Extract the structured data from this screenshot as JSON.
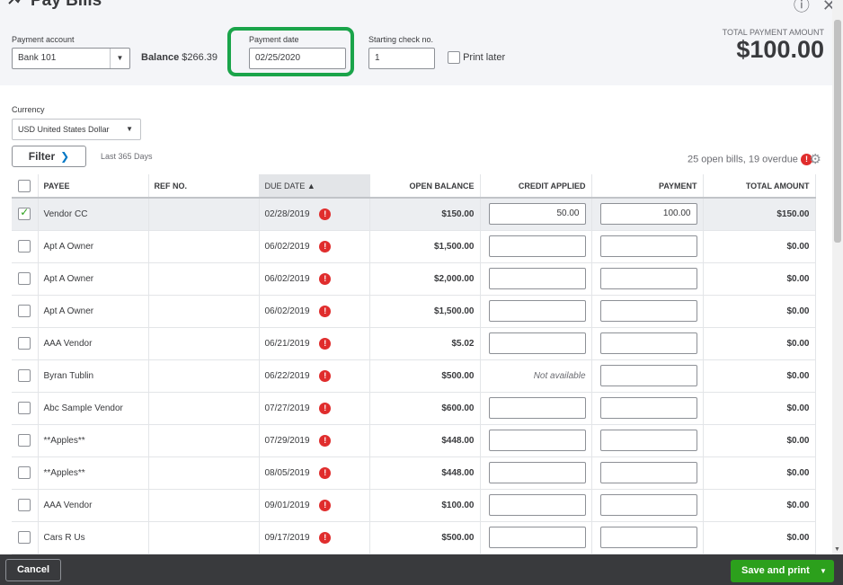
{
  "header": {
    "title": "Pay Bills",
    "help_icon": "question-circle-icon",
    "close_icon": "close-icon"
  },
  "payment": {
    "account_label": "Payment account",
    "account_value": "Bank 101",
    "balance_label": "Balance",
    "balance_value": "$266.39",
    "date_label": "Payment date",
    "date_value": "02/25/2020",
    "check_label": "Starting check no.",
    "check_value": "1",
    "print_later_label": "Print later",
    "total_label": "TOTAL PAYMENT AMOUNT",
    "total_value": "$100.00"
  },
  "currency": {
    "label": "Currency",
    "value": "USD United States Dollar"
  },
  "filter": {
    "button_label": "Filter",
    "range": "Last 365 Days",
    "summary": "25 open bills, 19 overdue"
  },
  "table": {
    "headers": {
      "payee": "PAYEE",
      "ref": "REF NO.",
      "due": "DUE DATE",
      "open": "OPEN BALANCE",
      "credit": "CREDIT APPLIED",
      "payment": "PAYMENT",
      "total": "TOTAL AMOUNT"
    },
    "rows": [
      {
        "checked": true,
        "payee": "Vendor CC",
        "ref": "",
        "due": "02/28/2019",
        "open": "$150.00",
        "credit": "50.00",
        "payment": "100.00",
        "total": "$150.00"
      },
      {
        "checked": false,
        "payee": "Apt A Owner",
        "ref": "",
        "due": "06/02/2019",
        "open": "$1,500.00",
        "credit": "",
        "payment": "",
        "total": "$0.00"
      },
      {
        "checked": false,
        "payee": "Apt A Owner",
        "ref": "",
        "due": "06/02/2019",
        "open": "$2,000.00",
        "credit": "",
        "payment": "",
        "total": "$0.00"
      },
      {
        "checked": false,
        "payee": "Apt A Owner",
        "ref": "",
        "due": "06/02/2019",
        "open": "$1,500.00",
        "credit": "",
        "payment": "",
        "total": "$0.00"
      },
      {
        "checked": false,
        "payee": "AAA Vendor",
        "ref": "",
        "due": "06/21/2019",
        "open": "$5.02",
        "credit": "",
        "payment": "",
        "total": "$0.00"
      },
      {
        "checked": false,
        "payee": "Byran Tublin",
        "ref": "",
        "due": "06/22/2019",
        "open": "$500.00",
        "credit": "Not available",
        "payment": "",
        "total": "$0.00"
      },
      {
        "checked": false,
        "payee": "Abc Sample Vendor",
        "ref": "",
        "due": "07/27/2019",
        "open": "$600.00",
        "credit": "",
        "payment": "",
        "total": "$0.00"
      },
      {
        "checked": false,
        "payee": "**Apples**",
        "ref": "",
        "due": "07/29/2019",
        "open": "$448.00",
        "credit": "",
        "payment": "",
        "total": "$0.00"
      },
      {
        "checked": false,
        "payee": "**Apples**",
        "ref": "",
        "due": "08/05/2019",
        "open": "$448.00",
        "credit": "",
        "payment": "",
        "total": "$0.00"
      },
      {
        "checked": false,
        "payee": "AAA Vendor",
        "ref": "",
        "due": "09/01/2019",
        "open": "$100.00",
        "credit": "",
        "payment": "",
        "total": "$0.00"
      },
      {
        "checked": false,
        "payee": "Cars R Us",
        "ref": "",
        "due": "09/17/2019",
        "open": "$500.00",
        "credit": "",
        "payment": "",
        "total": "$0.00"
      }
    ]
  },
  "footer": {
    "cancel_label": "Cancel",
    "save_label": "Save and print"
  },
  "colors": {
    "highlight_box": "#1aa44a",
    "primary_button": "#2ca01c",
    "overdue": "#e02d2d"
  }
}
